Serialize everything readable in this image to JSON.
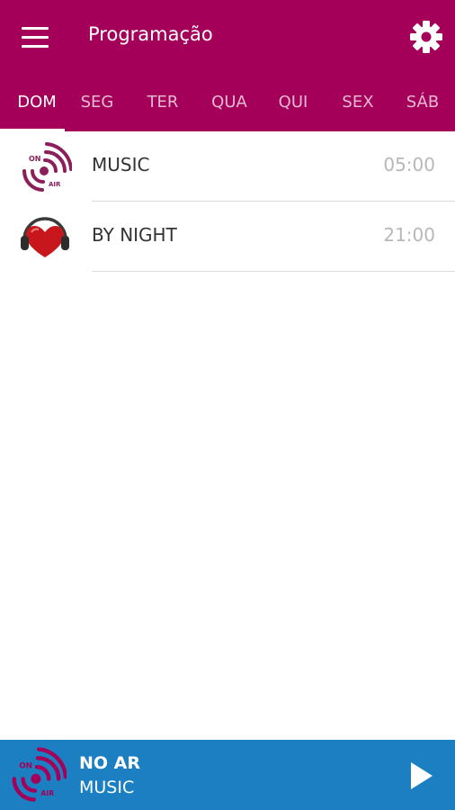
{
  "header": {
    "title": "Programação",
    "menu_icon": "hamburger-menu-icon",
    "settings_icon": "gear-icon"
  },
  "tabs": [
    {
      "label": "DOM",
      "active": true
    },
    {
      "label": "SEG",
      "active": false
    },
    {
      "label": "TER",
      "active": false
    },
    {
      "label": "QUA",
      "active": false
    },
    {
      "label": "QUI",
      "active": false
    },
    {
      "label": "SEX",
      "active": false
    },
    {
      "label": "SÁB",
      "active": false
    }
  ],
  "schedule": [
    {
      "name": "MUSIC",
      "time": "05:00",
      "icon": "on-air-logo-icon"
    },
    {
      "name": "BY NIGHT",
      "time": "21:00",
      "icon": "heart-headphones-icon"
    }
  ],
  "player": {
    "label": "NO AR",
    "program": "MUSIC",
    "logo_icon": "on-air-logo-icon",
    "play_icon": "play-icon"
  },
  "colors": {
    "header": "#a4005a",
    "player": "#1b7fc2",
    "time_text": "#b8b8b8"
  }
}
